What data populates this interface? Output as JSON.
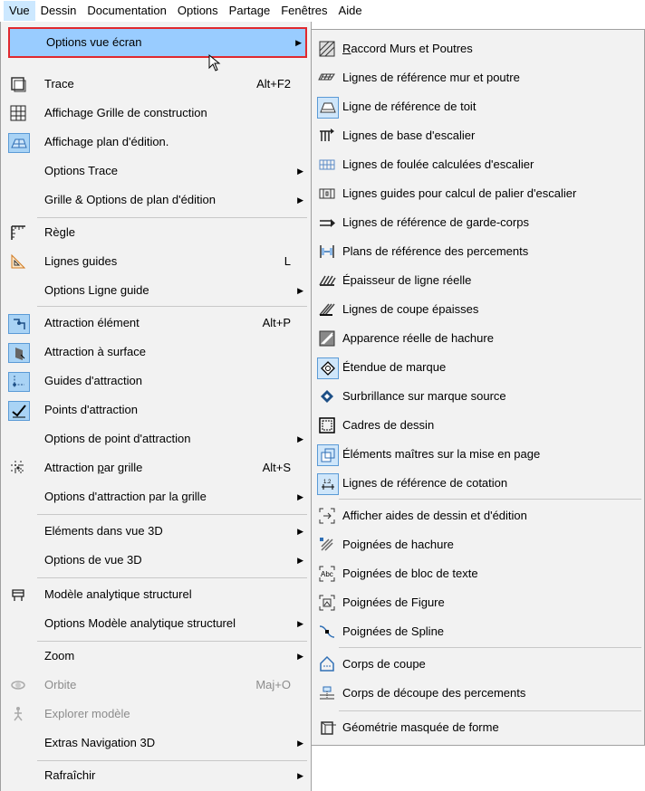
{
  "menubar": {
    "items": [
      "Vue",
      "Dessin",
      "Documentation",
      "Options",
      "Partage",
      "Fenêtres",
      "Aide"
    ]
  },
  "main_menu": {
    "items": [
      {
        "label": "Options vue écran",
        "shortcut": "",
        "icon": "",
        "submenu": true,
        "highlighted": true
      },
      {
        "label": "Trace",
        "shortcut": "Alt+F2",
        "icon": "trace-icon",
        "submenu": false
      },
      {
        "label": "Affichage Grille de construction",
        "shortcut": "",
        "icon": "construction-grid-icon",
        "submenu": false
      },
      {
        "label": "Affichage plan d'édition.",
        "shortcut": "",
        "icon": "editing-plane-icon",
        "submenu": false
      },
      {
        "label": "Options Trace",
        "shortcut": "",
        "icon": "",
        "submenu": true
      },
      {
        "label": "Grille & Options de plan d'édition",
        "shortcut": "",
        "icon": "",
        "submenu": true
      },
      {
        "label": "Règle",
        "shortcut": "",
        "icon": "ruler-icon",
        "submenu": false
      },
      {
        "label": "Lignes guides",
        "shortcut": "L",
        "icon": "guide-lines-icon",
        "submenu": false
      },
      {
        "label": "Options Ligne guide",
        "shortcut": "",
        "icon": "",
        "submenu": true
      },
      {
        "label": "Attraction élément",
        "shortcut": "Alt+P",
        "icon": "element-snap-icon",
        "submenu": false
      },
      {
        "label": "Attraction à surface",
        "shortcut": "",
        "icon": "surface-snap-icon",
        "submenu": false
      },
      {
        "label": "Guides d'attraction",
        "shortcut": "",
        "icon": "snap-guides-icon",
        "submenu": false
      },
      {
        "label": "Points d'attraction",
        "shortcut": "",
        "icon": "snap-points-icon",
        "submenu": false
      },
      {
        "label": "Options de point d'attraction",
        "shortcut": "",
        "icon": "",
        "submenu": true
      },
      {
        "label": "Attraction par grille",
        "shortcut": "Alt+S",
        "icon": "grid-snap-icon",
        "submenu": false
      },
      {
        "label": "Options d'attraction par la grille",
        "shortcut": "",
        "icon": "",
        "submenu": true
      },
      {
        "label": "Eléments dans vue 3D",
        "shortcut": "",
        "icon": "",
        "submenu": true
      },
      {
        "label": "Options de vue 3D",
        "shortcut": "",
        "icon": "",
        "submenu": true
      },
      {
        "label": "Modèle analytique structurel",
        "shortcut": "",
        "icon": "analytical-model-icon",
        "submenu": false
      },
      {
        "label": "Options Modèle analytique structurel",
        "shortcut": "",
        "icon": "",
        "submenu": true
      },
      {
        "label": "Zoom",
        "shortcut": "",
        "icon": "",
        "submenu": true
      },
      {
        "label": "Orbite",
        "shortcut": "Maj+O",
        "icon": "orbit-icon",
        "submenu": false,
        "disabled": true
      },
      {
        "label": "Explorer modèle",
        "shortcut": "",
        "icon": "explore-model-icon",
        "submenu": false,
        "disabled": true
      },
      {
        "label": "Extras Navigation 3D",
        "shortcut": "",
        "icon": "",
        "submenu": true
      },
      {
        "label": "Rafraîchir",
        "shortcut": "",
        "icon": "",
        "submenu": true
      }
    ]
  },
  "sub_menu": {
    "items": [
      {
        "label": "Raccord Murs et Poutres",
        "icon": "wall-beam-junction-icon"
      },
      {
        "label": "Lignes de référence mur et poutre",
        "icon": "wall-reference-line-icon"
      },
      {
        "label": "Ligne de référence de toit",
        "icon": "roof-reference-line-icon"
      },
      {
        "label": "Lignes de base d'escalier",
        "icon": "stair-baseline-icon"
      },
      {
        "label": "Lignes de foulée calculées d'escalier",
        "icon": "stair-walkline-icon"
      },
      {
        "label": "Lignes guides pour calcul de palier d'escalier",
        "icon": "stair-landing-guide-icon"
      },
      {
        "label": "Lignes de référence de garde-corps",
        "icon": "railing-reference-icon"
      },
      {
        "label": "Plans de référence des percements",
        "icon": "opening-reference-icon"
      },
      {
        "label": "Épaisseur de ligne réelle",
        "icon": "true-line-weight-icon"
      },
      {
        "label": "Lignes de coupe épaisses",
        "icon": "bold-cut-lines-icon"
      },
      {
        "label": "Apparence réelle de hachure",
        "icon": "vectorial-hatching-icon"
      },
      {
        "label": "Étendue de marque",
        "icon": "marker-range-icon"
      },
      {
        "label": "Surbrillance sur marque source",
        "icon": "source-marker-highlight-icon"
      },
      {
        "label": "Cadres de dessin",
        "icon": "drawing-frames-icon"
      },
      {
        "label": "Éléments maîtres sur la mise en page",
        "icon": "master-items-icon"
      },
      {
        "label": "Lignes de référence de cotation",
        "icon": "dimension-reference-icon"
      },
      {
        "label": "Afficher aides de dessin et d'édition",
        "icon": "drawing-aids-icon"
      },
      {
        "label": "Poignées de hachure",
        "icon": "hatch-handles-icon"
      },
      {
        "label": "Poignées de bloc de texte",
        "icon": "text-block-handles-icon"
      },
      {
        "label": "Poignées de Figure",
        "icon": "figure-handles-icon"
      },
      {
        "label": "Poignées de Spline",
        "icon": "spline-handles-icon"
      },
      {
        "label": "Corps de coupe",
        "icon": "cutting-body-icon"
      },
      {
        "label": "Corps de découpe des percements",
        "icon": "opening-cut-body-icon"
      },
      {
        "label": "Géométrie masquée de forme",
        "icon": "hidden-morph-geometry-icon"
      }
    ]
  },
  "colors": {
    "highlight": "#99ccff",
    "focus_border": "#e0282e",
    "menu_bg": "#f2f2f2"
  }
}
